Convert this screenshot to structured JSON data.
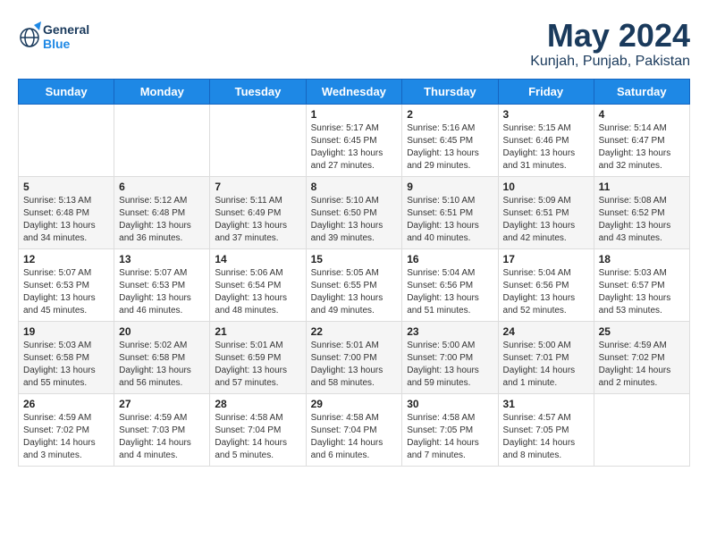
{
  "header": {
    "logo_line1": "General",
    "logo_line2": "Blue",
    "month": "May 2024",
    "location": "Kunjah, Punjab, Pakistan"
  },
  "weekdays": [
    "Sunday",
    "Monday",
    "Tuesday",
    "Wednesday",
    "Thursday",
    "Friday",
    "Saturday"
  ],
  "weeks": [
    [
      {
        "day": "",
        "info": ""
      },
      {
        "day": "",
        "info": ""
      },
      {
        "day": "",
        "info": ""
      },
      {
        "day": "1",
        "info": "Sunrise: 5:17 AM\nSunset: 6:45 PM\nDaylight: 13 hours\nand 27 minutes."
      },
      {
        "day": "2",
        "info": "Sunrise: 5:16 AM\nSunset: 6:45 PM\nDaylight: 13 hours\nand 29 minutes."
      },
      {
        "day": "3",
        "info": "Sunrise: 5:15 AM\nSunset: 6:46 PM\nDaylight: 13 hours\nand 31 minutes."
      },
      {
        "day": "4",
        "info": "Sunrise: 5:14 AM\nSunset: 6:47 PM\nDaylight: 13 hours\nand 32 minutes."
      }
    ],
    [
      {
        "day": "5",
        "info": "Sunrise: 5:13 AM\nSunset: 6:48 PM\nDaylight: 13 hours\nand 34 minutes."
      },
      {
        "day": "6",
        "info": "Sunrise: 5:12 AM\nSunset: 6:48 PM\nDaylight: 13 hours\nand 36 minutes."
      },
      {
        "day": "7",
        "info": "Sunrise: 5:11 AM\nSunset: 6:49 PM\nDaylight: 13 hours\nand 37 minutes."
      },
      {
        "day": "8",
        "info": "Sunrise: 5:10 AM\nSunset: 6:50 PM\nDaylight: 13 hours\nand 39 minutes."
      },
      {
        "day": "9",
        "info": "Sunrise: 5:10 AM\nSunset: 6:51 PM\nDaylight: 13 hours\nand 40 minutes."
      },
      {
        "day": "10",
        "info": "Sunrise: 5:09 AM\nSunset: 6:51 PM\nDaylight: 13 hours\nand 42 minutes."
      },
      {
        "day": "11",
        "info": "Sunrise: 5:08 AM\nSunset: 6:52 PM\nDaylight: 13 hours\nand 43 minutes."
      }
    ],
    [
      {
        "day": "12",
        "info": "Sunrise: 5:07 AM\nSunset: 6:53 PM\nDaylight: 13 hours\nand 45 minutes."
      },
      {
        "day": "13",
        "info": "Sunrise: 5:07 AM\nSunset: 6:53 PM\nDaylight: 13 hours\nand 46 minutes."
      },
      {
        "day": "14",
        "info": "Sunrise: 5:06 AM\nSunset: 6:54 PM\nDaylight: 13 hours\nand 48 minutes."
      },
      {
        "day": "15",
        "info": "Sunrise: 5:05 AM\nSunset: 6:55 PM\nDaylight: 13 hours\nand 49 minutes."
      },
      {
        "day": "16",
        "info": "Sunrise: 5:04 AM\nSunset: 6:56 PM\nDaylight: 13 hours\nand 51 minutes."
      },
      {
        "day": "17",
        "info": "Sunrise: 5:04 AM\nSunset: 6:56 PM\nDaylight: 13 hours\nand 52 minutes."
      },
      {
        "day": "18",
        "info": "Sunrise: 5:03 AM\nSunset: 6:57 PM\nDaylight: 13 hours\nand 53 minutes."
      }
    ],
    [
      {
        "day": "19",
        "info": "Sunrise: 5:03 AM\nSunset: 6:58 PM\nDaylight: 13 hours\nand 55 minutes."
      },
      {
        "day": "20",
        "info": "Sunrise: 5:02 AM\nSunset: 6:58 PM\nDaylight: 13 hours\nand 56 minutes."
      },
      {
        "day": "21",
        "info": "Sunrise: 5:01 AM\nSunset: 6:59 PM\nDaylight: 13 hours\nand 57 minutes."
      },
      {
        "day": "22",
        "info": "Sunrise: 5:01 AM\nSunset: 7:00 PM\nDaylight: 13 hours\nand 58 minutes."
      },
      {
        "day": "23",
        "info": "Sunrise: 5:00 AM\nSunset: 7:00 PM\nDaylight: 13 hours\nand 59 minutes."
      },
      {
        "day": "24",
        "info": "Sunrise: 5:00 AM\nSunset: 7:01 PM\nDaylight: 14 hours\nand 1 minute."
      },
      {
        "day": "25",
        "info": "Sunrise: 4:59 AM\nSunset: 7:02 PM\nDaylight: 14 hours\nand 2 minutes."
      }
    ],
    [
      {
        "day": "26",
        "info": "Sunrise: 4:59 AM\nSunset: 7:02 PM\nDaylight: 14 hours\nand 3 minutes."
      },
      {
        "day": "27",
        "info": "Sunrise: 4:59 AM\nSunset: 7:03 PM\nDaylight: 14 hours\nand 4 minutes."
      },
      {
        "day": "28",
        "info": "Sunrise: 4:58 AM\nSunset: 7:04 PM\nDaylight: 14 hours\nand 5 minutes."
      },
      {
        "day": "29",
        "info": "Sunrise: 4:58 AM\nSunset: 7:04 PM\nDaylight: 14 hours\nand 6 minutes."
      },
      {
        "day": "30",
        "info": "Sunrise: 4:58 AM\nSunset: 7:05 PM\nDaylight: 14 hours\nand 7 minutes."
      },
      {
        "day": "31",
        "info": "Sunrise: 4:57 AM\nSunset: 7:05 PM\nDaylight: 14 hours\nand 8 minutes."
      },
      {
        "day": "",
        "info": ""
      }
    ]
  ]
}
